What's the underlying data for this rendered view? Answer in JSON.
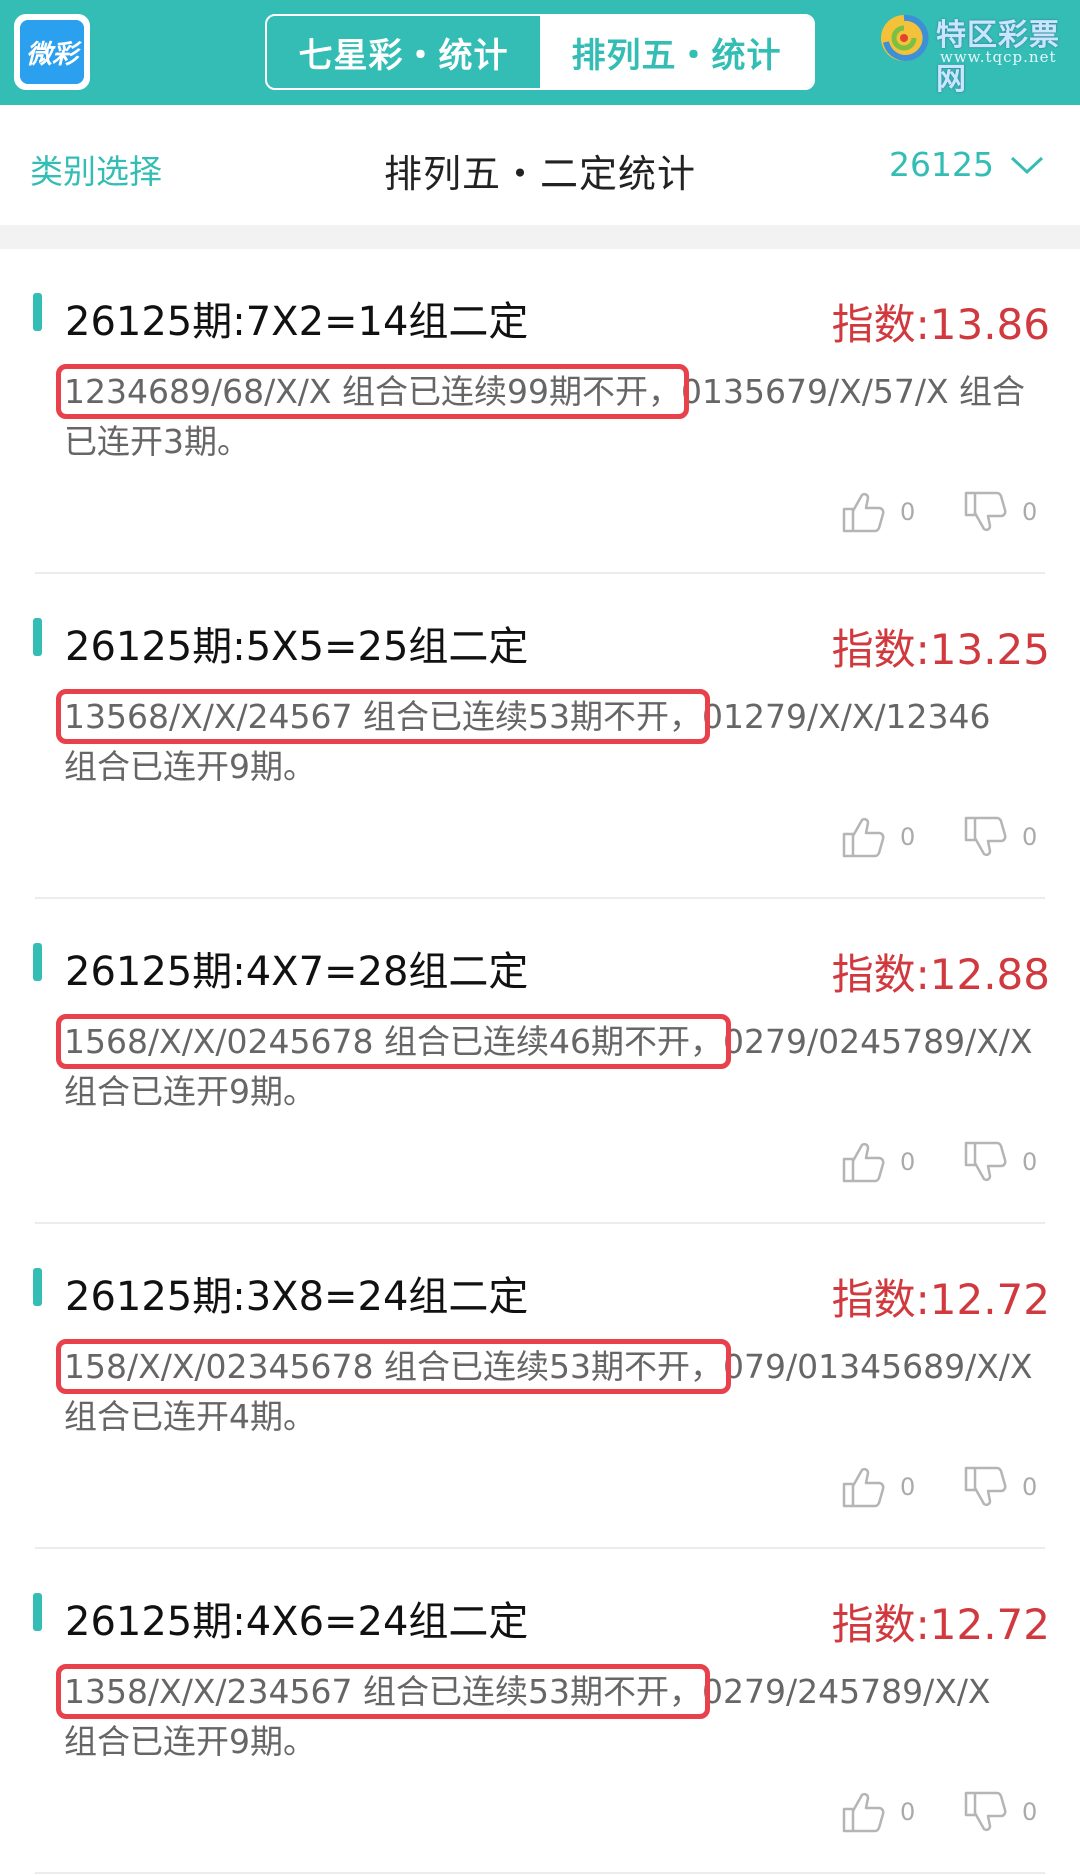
{
  "header": {
    "logo_text": "微彩",
    "tabs": [
      {
        "label": "七星彩・统计",
        "active": false
      },
      {
        "label": "排列五・统计",
        "active": true
      }
    ],
    "watermark": {
      "name": "特区彩票网",
      "url": "www.tqcp.net"
    }
  },
  "subheader": {
    "category_label": "类别选择",
    "title": "排列五・二定统计",
    "period": "26125"
  },
  "colors": {
    "accent": "#33bdb4",
    "index_red": "#d0393e",
    "highlight_box": "#e8414c"
  },
  "cards": [
    {
      "title": "26125期:7X2=14组二定",
      "index": "指数:13.86",
      "highlight": "1234689/68/X/X 组合已连续99期不开，",
      "rest": "0135679/X/57/X 组合已连开3期。",
      "likes": "0",
      "dislikes": "0"
    },
    {
      "title": "26125期:5X5=25组二定",
      "index": "指数:13.25",
      "highlight": "13568/X/X/24567 组合已连续53期不开，",
      "rest": "01279/X/X/12346 组合已连开9期。",
      "likes": "0",
      "dislikes": "0"
    },
    {
      "title": "26125期:4X7=28组二定",
      "index": "指数:12.88",
      "highlight": "1568/X/X/0245678 组合已连续46期不开，",
      "rest": "0279/0245789/X/X 组合已连开9期。",
      "likes": "0",
      "dislikes": "0"
    },
    {
      "title": "26125期:3X8=24组二定",
      "index": "指数:12.72",
      "highlight": "158/X/X/02345678 组合已连续53期不开，",
      "rest": "079/01345689/X/X 组合已连开4期。",
      "likes": "0",
      "dislikes": "0"
    },
    {
      "title": "26125期:4X6=24组二定",
      "index": "指数:12.72",
      "highlight": "1358/X/X/234567 组合已连续53期不开，",
      "rest": "0279/245789/X/X 组合已连开9期。",
      "likes": "0",
      "dislikes": "0"
    }
  ]
}
